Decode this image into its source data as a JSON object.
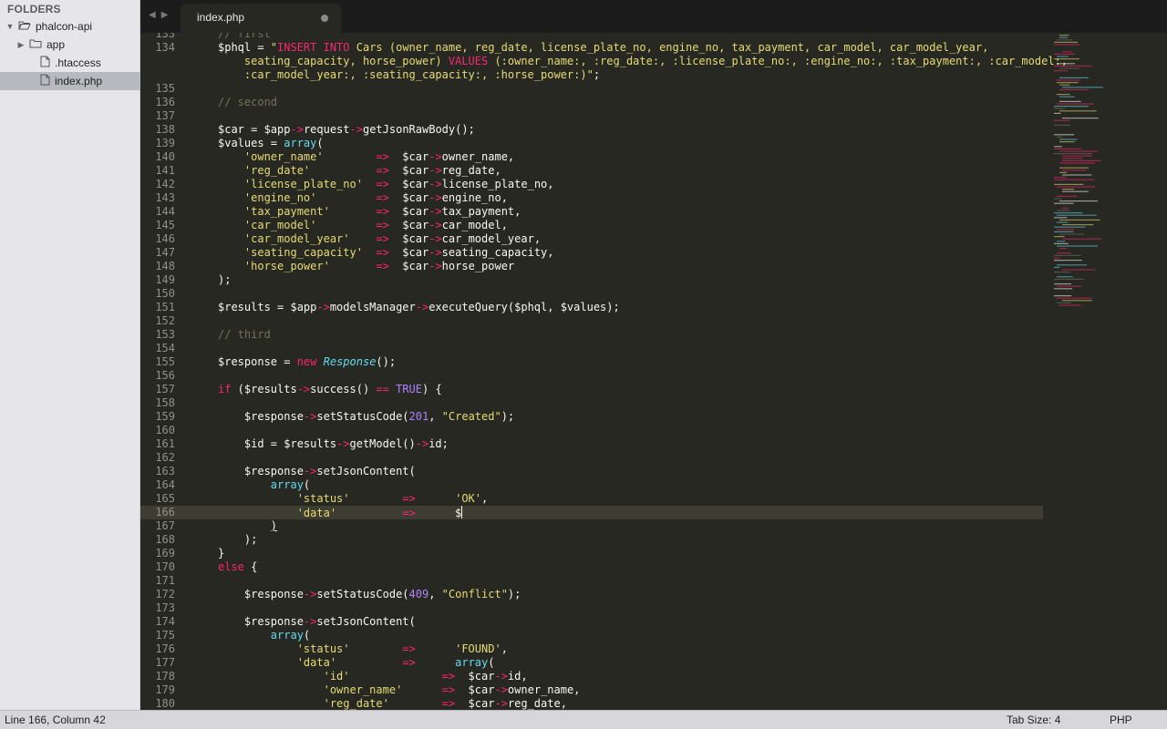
{
  "sidebar": {
    "header": "FOLDERS",
    "items": [
      {
        "label": "phalcon-api",
        "arrow": "▼",
        "indent": 10,
        "icon": "folder-open-icon"
      },
      {
        "label": "app",
        "arrow": "▶",
        "indent": 22,
        "icon": "folder-icon"
      },
      {
        "label": ".htaccess",
        "arrow": "",
        "indent": 34,
        "icon": "file-icon"
      },
      {
        "label": "index.php",
        "arrow": "",
        "indent": 34,
        "icon": "file-icon",
        "selected": true
      }
    ]
  },
  "tabs": {
    "nav_back": "◀",
    "nav_fwd": "▶",
    "active": "index.php"
  },
  "editor": {
    "cursor_line": 166,
    "lines": [
      {
        "n": "133",
        "html": "<span class=\"c\">// first</span>"
      },
      {
        "n": "134",
        "html": "$phql = <span class=\"s\">\"</span><span class=\"k\">INSERT INTO</span><span class=\"s\"> Cars (owner_name, reg_date, license_plate_no, engine_no, tax_payment, car_model, car_model_year,</span>"
      },
      {
        "n": "",
        "html": "<span class=\"s\">    seating_capacity, horse_power) </span><span class=\"k\">VALUES</span><span class=\"s\"> (:owner_name:, :reg_date:, :license_plate_no:, :engine_no:, :tax_payment:, :car_model:,</span>"
      },
      {
        "n": "",
        "html": "<span class=\"s\">    :car_model_year:, :seating_capacity:, :horse_power:)\"</span>;"
      },
      {
        "n": "135",
        "html": ""
      },
      {
        "n": "136",
        "html": "<span class=\"c\">// second</span>"
      },
      {
        "n": "137",
        "html": ""
      },
      {
        "n": "138",
        "html": "$car = $app<span class=\"a\">-&gt;</span>request<span class=\"a\">-&gt;</span>getJsonRawBody();"
      },
      {
        "n": "139",
        "html": "$values = <span class=\"cls\" style=\"font-style:normal\">array</span>("
      },
      {
        "n": "140",
        "html": "    <span class=\"s\">'owner_name'</span>        <span class=\"k\">=&gt;</span>  $car<span class=\"a\">-&gt;</span>owner_name,"
      },
      {
        "n": "141",
        "html": "    <span class=\"s\">'reg_date'</span>          <span class=\"k\">=&gt;</span>  $car<span class=\"a\">-&gt;</span>reg_date,"
      },
      {
        "n": "142",
        "html": "    <span class=\"s\">'license_plate_no'</span>  <span class=\"k\">=&gt;</span>  $car<span class=\"a\">-&gt;</span>license_plate_no,"
      },
      {
        "n": "143",
        "html": "    <span class=\"s\">'engine_no'</span>         <span class=\"k\">=&gt;</span>  $car<span class=\"a\">-&gt;</span>engine_no,"
      },
      {
        "n": "144",
        "html": "    <span class=\"s\">'tax_payment'</span>       <span class=\"k\">=&gt;</span>  $car<span class=\"a\">-&gt;</span>tax_payment,"
      },
      {
        "n": "145",
        "html": "    <span class=\"s\">'car_model'</span>         <span class=\"k\">=&gt;</span>  $car<span class=\"a\">-&gt;</span>car_model,"
      },
      {
        "n": "146",
        "html": "    <span class=\"s\">'car_model_year'</span>    <span class=\"k\">=&gt;</span>  $car<span class=\"a\">-&gt;</span>car_model_year,"
      },
      {
        "n": "147",
        "html": "    <span class=\"s\">'seating_capacity'</span>  <span class=\"k\">=&gt;</span>  $car<span class=\"a\">-&gt;</span>seating_capacity,"
      },
      {
        "n": "148",
        "html": "    <span class=\"s\">'horse_power'</span>       <span class=\"k\">=&gt;</span>  $car<span class=\"a\">-&gt;</span>horse_power"
      },
      {
        "n": "149",
        "html": ");"
      },
      {
        "n": "150",
        "html": ""
      },
      {
        "n": "151",
        "html": "$results = $app<span class=\"a\">-&gt;</span>modelsManager<span class=\"a\">-&gt;</span>executeQuery($phql, $values);"
      },
      {
        "n": "152",
        "html": ""
      },
      {
        "n": "153",
        "html": "<span class=\"c\">// third</span>"
      },
      {
        "n": "154",
        "html": ""
      },
      {
        "n": "155",
        "html": "$response = <span class=\"k\">new</span> <span class=\"cls\">Response</span>();"
      },
      {
        "n": "156",
        "html": ""
      },
      {
        "n": "157",
        "html": "<span class=\"k\">if</span> ($results<span class=\"a\">-&gt;</span>success() <span class=\"k\">==</span> <span class=\"n\">TRUE</span>) {"
      },
      {
        "n": "158",
        "html": ""
      },
      {
        "n": "159",
        "html": "    $response<span class=\"a\">-&gt;</span>setStatusCode(<span class=\"n\">201</span>, <span class=\"s\">\"Created\"</span>);"
      },
      {
        "n": "160",
        "html": ""
      },
      {
        "n": "161",
        "html": "    $id = $results<span class=\"a\">-&gt;</span>getModel()<span class=\"a\">-&gt;</span>id;"
      },
      {
        "n": "162",
        "html": ""
      },
      {
        "n": "163",
        "html": "    $response<span class=\"a\">-&gt;</span>setJsonContent("
      },
      {
        "n": "164",
        "html": "        <span class=\"cls\" style=\"font-style:normal\">array</span>("
      },
      {
        "n": "165",
        "html": "            <span class=\"s\">'status'</span>        <span class=\"k\">=&gt;</span>      <span class=\"s\">'OK'</span>,"
      },
      {
        "n": "166",
        "html": "            <span class=\"s\">'data'</span>          <span class=\"k\">=&gt;</span>      $<span class=\"cursor\"></span>"
      },
      {
        "n": "167",
        "html": "        <span style=\"text-decoration:underline\">)</span>"
      },
      {
        "n": "168",
        "html": "    );"
      },
      {
        "n": "169",
        "html": "}"
      },
      {
        "n": "170",
        "html": "<span class=\"k\">else</span> {"
      },
      {
        "n": "171",
        "html": ""
      },
      {
        "n": "172",
        "html": "    $response<span class=\"a\">-&gt;</span>setStatusCode(<span class=\"n\">409</span>, <span class=\"s\">\"Conflict\"</span>);"
      },
      {
        "n": "173",
        "html": ""
      },
      {
        "n": "174",
        "html": "    $response<span class=\"a\">-&gt;</span>setJsonContent("
      },
      {
        "n": "175",
        "html": "        <span class=\"cls\" style=\"font-style:normal\">array</span>("
      },
      {
        "n": "176",
        "html": "            <span class=\"s\">'status'</span>        <span class=\"k\">=&gt;</span>      <span class=\"s\">'FOUND'</span>,"
      },
      {
        "n": "177",
        "html": "            <span class=\"s\">'data'</span>          <span class=\"k\">=&gt;</span>      <span class=\"cls\" style=\"font-style:normal\">array</span>("
      },
      {
        "n": "178",
        "html": "                <span class=\"s\">'id'</span>              <span class=\"k\">=&gt;</span>  $car<span class=\"a\">-&gt;</span>id,"
      },
      {
        "n": "179",
        "html": "                <span class=\"s\">'owner_name'</span>      <span class=\"k\">=&gt;</span>  $car<span class=\"a\">-&gt;</span>owner_name,"
      },
      {
        "n": "180",
        "html": "                <span class=\"s\">'reg_date'</span>        <span class=\"k\">=&gt;</span>  $car<span class=\"a\">-&gt;</span>reg_date,"
      }
    ]
  },
  "status": {
    "position": "Line 166, Column 42",
    "tab_size": "Tab Size: 4",
    "syntax": "PHP"
  }
}
